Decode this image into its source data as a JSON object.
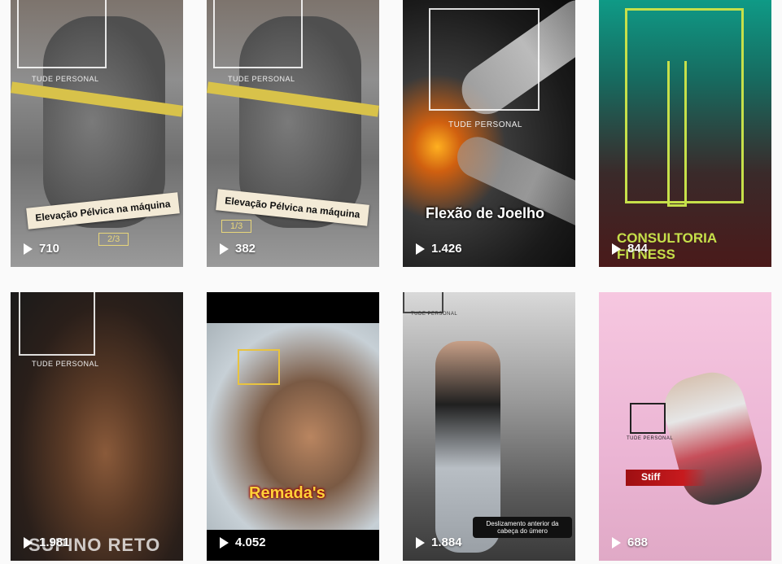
{
  "tiles": [
    {
      "brand": "TUDE PERSONAL",
      "title": "Elevação Pélvica na máquina",
      "badge": "2/3",
      "views": "710"
    },
    {
      "brand": "TUDE PERSONAL",
      "title": "Elevação Pélvica na máquina",
      "badge": "1/3",
      "views": "382"
    },
    {
      "brand": "TUDE PERSONAL",
      "title": "Flexão de Joelho",
      "views": "1.426"
    },
    {
      "title": "CONSULTORIA FITNESS",
      "views": "844"
    },
    {
      "brand": "TUDE PERSONAL",
      "title": "SUPINO RETO",
      "views": "1.981"
    },
    {
      "title": "Remada's",
      "views": "4.052"
    },
    {
      "brand": "TUDE PERSONAL",
      "title": "Deslizamento anterior da cabeça do úmero",
      "views": "1.884"
    },
    {
      "brand": "TUDE PERSONAL",
      "title": "Stiff",
      "views": "688"
    }
  ]
}
